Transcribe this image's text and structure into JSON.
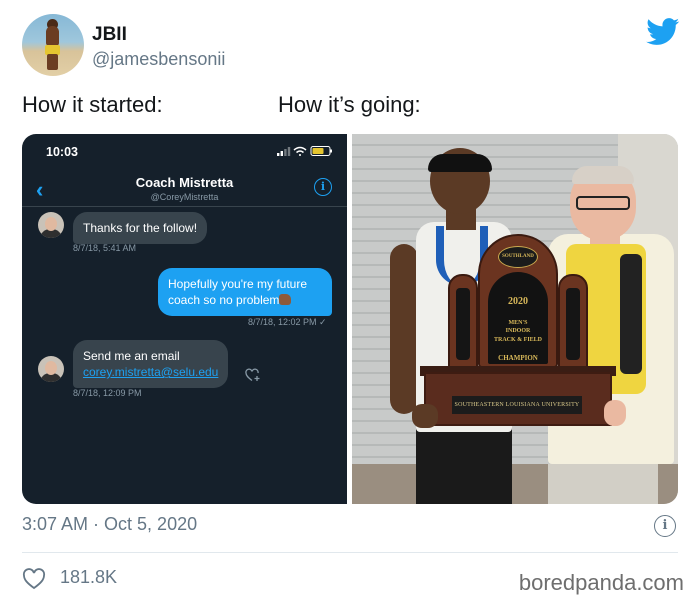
{
  "tweet": {
    "display_name": "JBII",
    "handle": "@jamesbensonii",
    "caption_left": "How it started:",
    "caption_right": "How it’s going:",
    "timestamp": "3:07 AM · Oct 5, 2020",
    "likes": "181.8K",
    "info_glyph": "i"
  },
  "dm_screenshot": {
    "status_time": "10:03",
    "contact_name": "Coach Mistretta",
    "contact_handle": "@CoreyMistretta",
    "info_glyph": "i",
    "back_glyph": "‹",
    "messages": [
      {
        "text": "Thanks for the follow!",
        "time": "8/7/18, 5:41 AM"
      },
      {
        "line1": "Hopefully you're my future",
        "line2": "coach so no problem",
        "time": "8/7/18, 12:02 PM ✓"
      },
      {
        "line1": "Send me an email",
        "email": "corey.mistretta@selu.edu",
        "time": "8/7/18, 12:09 PM"
      }
    ]
  },
  "photo": {
    "trophy_logo": "SOUTHLAND",
    "trophy_year": "2020",
    "trophy_line2": "MEN'S",
    "trophy_line3": "INDOOR",
    "trophy_line4": "TRACK & FIELD",
    "trophy_line5": "CHAMPION",
    "base_plate": "SOUTHEASTERN LOUISIANA UNIVERSITY"
  },
  "watermark": "boredpanda.com",
  "colors": {
    "twitter_blue": "#1da1f2",
    "dm_background": "#15202b",
    "text_secondary": "#657786"
  },
  "icons": [
    "twitter-bird-icon",
    "info-icon",
    "heart-icon",
    "back-chevron-icon",
    "heart-plus-icon",
    "signal-icon",
    "wifi-icon",
    "battery-icon"
  ]
}
